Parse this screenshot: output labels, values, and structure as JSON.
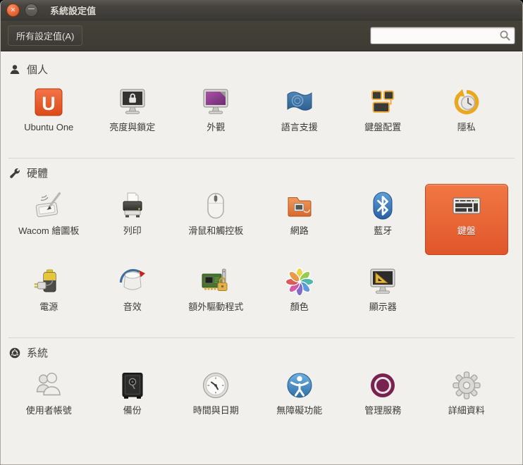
{
  "window": {
    "title": "系統設定值",
    "close_glyph": "✕",
    "minimize_glyph": "—"
  },
  "toolbar": {
    "all_settings_label": "所有設定值(A)",
    "search_value": "",
    "search_placeholder": "",
    "search_icon": "search-icon"
  },
  "colors": {
    "accent": "#E0562A",
    "titlebar": "#3C3A36",
    "content_background": "#F1F0ED",
    "selected_tile": "#E8683A",
    "separator": "#D8D6D1"
  },
  "sections": [
    {
      "id": "personal",
      "label": "個人",
      "icon": "person-icon",
      "items": [
        {
          "id": "ubuntu-one",
          "label": "Ubuntu One",
          "icon": "ubuntu-one-icon"
        },
        {
          "id": "brightness-lock",
          "label": "亮度與鎖定",
          "icon": "brightness-lock-icon"
        },
        {
          "id": "appearance",
          "label": "外觀",
          "icon": "appearance-icon"
        },
        {
          "id": "language-support",
          "label": "語言支援",
          "icon": "language-support-icon"
        },
        {
          "id": "keyboard-layout",
          "label": "鍵盤配置",
          "icon": "keyboard-layout-icon"
        },
        {
          "id": "privacy",
          "label": "隱私",
          "icon": "privacy-icon"
        }
      ]
    },
    {
      "id": "hardware",
      "label": "硬體",
      "icon": "wrench-icon",
      "items": [
        {
          "id": "wacom-tablet",
          "label": "Wacom 繪圖板",
          "icon": "wacom-tablet-icon"
        },
        {
          "id": "printing",
          "label": "列印",
          "icon": "printer-icon"
        },
        {
          "id": "mouse-touchpad",
          "label": "滑鼠和觸控板",
          "icon": "mouse-icon"
        },
        {
          "id": "network",
          "label": "網路",
          "icon": "network-icon"
        },
        {
          "id": "bluetooth",
          "label": "藍牙",
          "icon": "bluetooth-icon"
        },
        {
          "id": "keyboard",
          "label": "鍵盤",
          "icon": "keyboard-icon",
          "selected": true
        },
        {
          "id": "power",
          "label": "電源",
          "icon": "power-icon"
        },
        {
          "id": "sound",
          "label": "音效",
          "icon": "sound-icon"
        },
        {
          "id": "additional-drivers",
          "label": "額外驅動程式",
          "icon": "additional-drivers-icon"
        },
        {
          "id": "color",
          "label": "顏色",
          "icon": "color-icon"
        },
        {
          "id": "displays",
          "label": "顯示器",
          "icon": "displays-icon"
        }
      ]
    },
    {
      "id": "system",
      "label": "系統",
      "icon": "ubuntu-logo-icon",
      "items": [
        {
          "id": "user-accounts",
          "label": "使用者帳號",
          "icon": "user-accounts-icon"
        },
        {
          "id": "backup",
          "label": "備份",
          "icon": "backup-icon"
        },
        {
          "id": "time-date",
          "label": "時間與日期",
          "icon": "time-date-icon"
        },
        {
          "id": "universal-access",
          "label": "無障礙功能",
          "icon": "universal-access-icon"
        },
        {
          "id": "landscape-service",
          "label": "管理服務",
          "icon": "landscape-service-icon"
        },
        {
          "id": "details",
          "label": "詳細資料",
          "icon": "details-icon"
        }
      ]
    }
  ]
}
